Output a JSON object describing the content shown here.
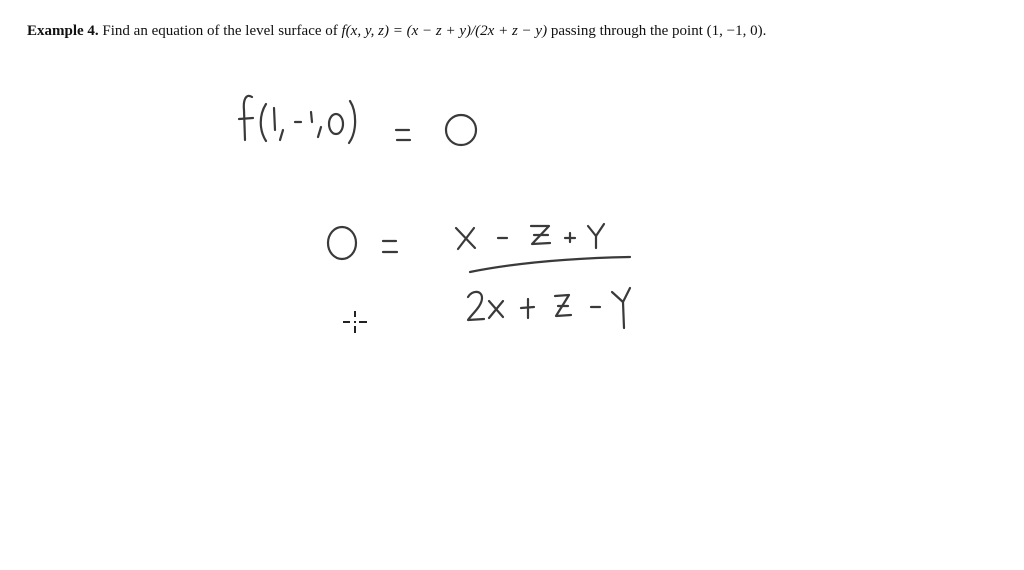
{
  "problem": {
    "label": "Example 4.",
    "text_before": "Find an equation of the level surface of",
    "function": "f(x, y, z) = (x − z + y)/(2x + z − y)",
    "text_after": "passing through the point",
    "point": "(1, −1, 0)."
  },
  "handwriting": {
    "line1": "f(1,-1,0) = 0",
    "line2_lhs": "0 =",
    "numerator": "x - z + y",
    "denominator": "2x + z - y"
  },
  "cursor": {
    "type": "crosshair-cursor"
  }
}
